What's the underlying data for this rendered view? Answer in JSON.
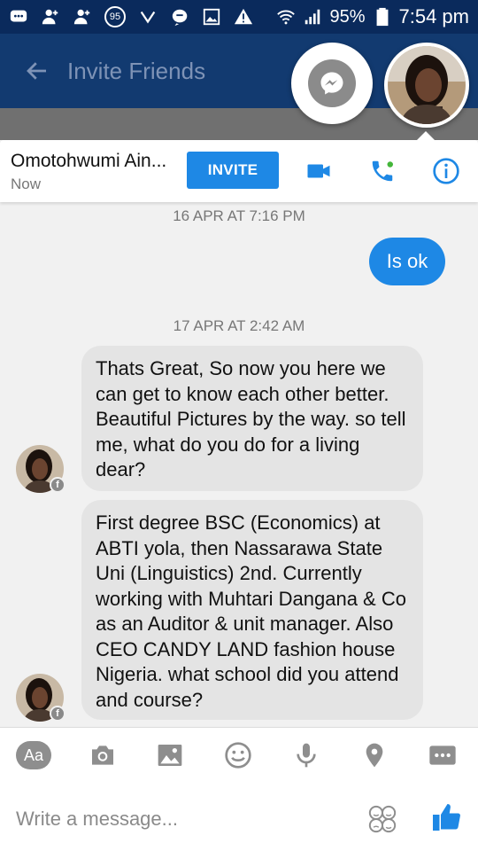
{
  "status_bar": {
    "notification_count": "95",
    "battery": "95%",
    "time": "7:54 pm"
  },
  "app_bar": {
    "title": "Invite Friends"
  },
  "chat_header": {
    "contact_name": "Omotohwumi Ain...",
    "presence": "Now",
    "invite_label": "INVITE"
  },
  "conversation": {
    "timestamp_1": "16 APR AT 7:16 PM",
    "outgoing_1": "Is ok",
    "timestamp_2": "17 APR AT 2:42 AM",
    "incoming_1": "Thats Great, So now you here we can get to know each other better. Beautiful Pictures by the way. so tell me, what do you do for a living dear?",
    "incoming_2": "First degree BSC (Economics) at ABTI yola, then Nassarawa State Uni (Linguistics) 2nd. Currently working with Muhtari Dangana & Co as an Auditor & unit manager. Also CEO CANDY LAND fashion house Nigeria. what school did you attend and course?"
  },
  "composer": {
    "aa_label": "Aa",
    "placeholder": "Write a message..."
  },
  "colors": {
    "status_bar_bg": "#0a2a5c",
    "app_bar_bg": "#123a70",
    "accent_blue": "#1e88e5",
    "incoming_bubble": "#e4e4e4",
    "icon_gray": "#8e8e8e"
  },
  "icons": {
    "status_bar": [
      "chat-bubble-icon",
      "add-friend-icon",
      "add-friend-icon",
      "notification-count-badge",
      "check-icon",
      "message-icon",
      "image-icon",
      "warning-icon",
      "wifi-icon",
      "signal-icon",
      "battery-icon"
    ],
    "chat_header": [
      "video-call-icon",
      "voice-call-icon",
      "info-icon"
    ],
    "composer": [
      "camera-icon",
      "gallery-icon",
      "emoji-icon",
      "microphone-icon",
      "location-icon",
      "more-icon",
      "stickers-icon",
      "thumbs-up-icon"
    ]
  }
}
